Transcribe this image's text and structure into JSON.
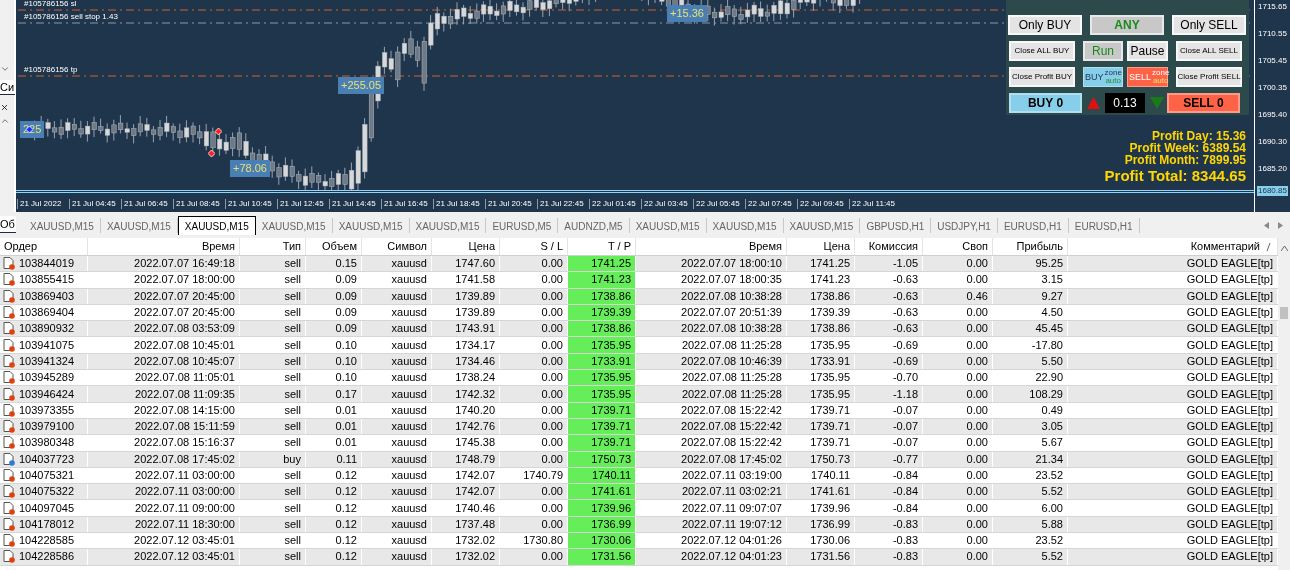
{
  "side_strip": {
    "labels": [
      "Си",
      "Об"
    ]
  },
  "chart": {
    "order_lines": [
      {
        "label": "#105786156 sl",
        "kind": "sl"
      },
      {
        "label": "#105786156 sell stop 1.43",
        "kind": "pending"
      },
      {
        "label": "#105786156 tp",
        "kind": "tp"
      }
    ],
    "profit_labels": [
      "225",
      "+78.06",
      "+255.05",
      "+15.36"
    ],
    "price_axis": [
      {
        "label": "1715.65",
        "current": false
      },
      {
        "label": "1710.55",
        "current": false
      },
      {
        "label": "1705.45",
        "current": false
      },
      {
        "label": "1700.35",
        "current": false
      },
      {
        "label": "1695.40",
        "current": false
      },
      {
        "label": "1690.30",
        "current": false
      },
      {
        "label": "1685.20",
        "current": false
      },
      {
        "label": "1680.85",
        "current": true
      }
    ],
    "time_axis": [
      "21 Jul 2022",
      "21 Jul 04:45",
      "21 Jul 06:45",
      "21 Jul 08:45",
      "21 Jul 10:45",
      "21 Jul 12:45",
      "21 Jul 14:45",
      "21 Jul 16:45",
      "21 Jul 18:45",
      "21 Jul 20:45",
      "21 Jul 22:45",
      "22 Jul 01:45",
      "22 Jul 03:45",
      "22 Jul 05:45",
      "22 Jul 07:45",
      "22 Jul 09:45",
      "22 Jul 11:45"
    ]
  },
  "panel": {
    "mode_buttons": [
      {
        "label": "Only BUY",
        "selected": false
      },
      {
        "label": "ANY",
        "selected": true
      },
      {
        "label": "Only SELL",
        "selected": false
      }
    ],
    "row2": [
      {
        "label": "Close ALL BUY",
        "kind": "close"
      },
      {
        "label": "Run",
        "kind": "toggle",
        "selected": true
      },
      {
        "label": "Pause",
        "kind": "toggle",
        "selected": false
      },
      {
        "label": "Close ALL SELL",
        "kind": "close"
      }
    ],
    "row3": [
      {
        "label": "Close Profit BUY",
        "kind": "close"
      },
      {
        "label": "BUY",
        "kind": "zone_buy",
        "sup": "zone",
        "sub": "auto"
      },
      {
        "label": "SELL",
        "kind": "zone_sell",
        "sup": "zone",
        "sub": "auto"
      },
      {
        "label": "Close Profit SELL",
        "kind": "close"
      }
    ],
    "buy_counter": "BUY 0",
    "lot": "0.13",
    "sell_counter": "SELL 0"
  },
  "profit": [
    {
      "text": "Profit Day: 15.36",
      "kind": "period"
    },
    {
      "text": "Profit Week: 6389.54",
      "kind": "period"
    },
    {
      "text": "Profit Month: 7899.95",
      "kind": "period"
    },
    {
      "text": "Profit Total: 8344.65",
      "kind": "total"
    }
  ],
  "tabs": [
    {
      "label": "XAUUSD,M15",
      "selected": false
    },
    {
      "label": "XAUUSD,M15",
      "selected": false
    },
    {
      "label": "XAUUSD,M15",
      "selected": true
    },
    {
      "label": "XAUUSD,M15",
      "selected": false
    },
    {
      "label": "XAUUSD,M15",
      "selected": false
    },
    {
      "label": "XAUUSD,M15",
      "selected": false
    },
    {
      "label": "EURUSD,M5",
      "selected": false
    },
    {
      "label": "AUDNZD,M5",
      "selected": false
    },
    {
      "label": "XAUUSD,M15",
      "selected": false
    },
    {
      "label": "XAUUSD,M15",
      "selected": false
    },
    {
      "label": "XAUUSD,M15",
      "selected": false
    },
    {
      "label": "GBPUSD,H1",
      "selected": false
    },
    {
      "label": "USDJPY,H1",
      "selected": false
    },
    {
      "label": "EURUSD,H1",
      "selected": false
    },
    {
      "label": "EURUSD,H1",
      "selected": false
    }
  ],
  "table": {
    "columns": [
      {
        "label": "Ордер",
        "sorted": false
      },
      {
        "label": "Время",
        "sorted": false
      },
      {
        "label": "Тип",
        "sorted": false
      },
      {
        "label": "Объем",
        "sorted": false
      },
      {
        "label": "Символ",
        "sorted": false
      },
      {
        "label": "Цена",
        "sorted": false
      },
      {
        "label": "S / L",
        "sorted": false
      },
      {
        "label": "T / P",
        "sorted": false
      },
      {
        "label": "Время",
        "sorted": false
      },
      {
        "label": "Цена",
        "sorted": false
      },
      {
        "label": "Комиссия",
        "sorted": false
      },
      {
        "label": "Своп",
        "sorted": false
      },
      {
        "label": "Прибыль",
        "sorted": false
      },
      {
        "label": "Комментарий",
        "sorted": true
      }
    ],
    "rows": [
      {
        "kind": "sell",
        "cells": [
          "103844019",
          "2022.07.07 16:49:18",
          "sell",
          "0.15",
          "xauusd",
          "1747.60",
          "0.00",
          "1741.25",
          "2022.07.07 18:00:10",
          "1741.25",
          "-1.05",
          "0.00",
          "95.25",
          "GOLD EAGLE[tp]"
        ]
      },
      {
        "kind": "sell",
        "cells": [
          "103855415",
          "2022.07.07 18:00:00",
          "sell",
          "0.09",
          "xauusd",
          "1741.58",
          "0.00",
          "1741.23",
          "2022.07.07 18:00:35",
          "1741.23",
          "-0.63",
          "0.00",
          "3.15",
          "GOLD EAGLE[tp]"
        ]
      },
      {
        "kind": "sell",
        "cells": [
          "103869403",
          "2022.07.07 20:45:00",
          "sell",
          "0.09",
          "xauusd",
          "1739.89",
          "0.00",
          "1738.86",
          "2022.07.08 10:38:28",
          "1738.86",
          "-0.63",
          "0.46",
          "9.27",
          "GOLD EAGLE[tp]"
        ]
      },
      {
        "kind": "sell",
        "cells": [
          "103869404",
          "2022.07.07 20:45:00",
          "sell",
          "0.09",
          "xauusd",
          "1739.89",
          "0.00",
          "1739.39",
          "2022.07.07 20:51:39",
          "1739.39",
          "-0.63",
          "0.00",
          "4.50",
          "GOLD EAGLE[tp]"
        ]
      },
      {
        "kind": "sell",
        "cells": [
          "103890932",
          "2022.07.08 03:53:09",
          "sell",
          "0.09",
          "xauusd",
          "1743.91",
          "0.00",
          "1738.86",
          "2022.07.08 10:38:28",
          "1738.86",
          "-0.63",
          "0.00",
          "45.45",
          "GOLD EAGLE[tp]"
        ]
      },
      {
        "kind": "sell",
        "cells": [
          "103941075",
          "2022.07.08 10:45:01",
          "sell",
          "0.10",
          "xauusd",
          "1734.17",
          "0.00",
          "1735.95",
          "2022.07.08 11:25:28",
          "1735.95",
          "-0.69",
          "0.00",
          "-17.80",
          "GOLD EAGLE[tp]"
        ]
      },
      {
        "kind": "sell",
        "cells": [
          "103941324",
          "2022.07.08 10:45:07",
          "sell",
          "0.10",
          "xauusd",
          "1734.46",
          "0.00",
          "1733.91",
          "2022.07.08 10:46:39",
          "1733.91",
          "-0.69",
          "0.00",
          "5.50",
          "GOLD EAGLE[tp]"
        ]
      },
      {
        "kind": "sell",
        "cells": [
          "103945289",
          "2022.07.08 11:05:01",
          "sell",
          "0.10",
          "xauusd",
          "1738.24",
          "0.00",
          "1735.95",
          "2022.07.08 11:25:28",
          "1735.95",
          "-0.70",
          "0.00",
          "22.90",
          "GOLD EAGLE[tp]"
        ]
      },
      {
        "kind": "sell",
        "cells": [
          "103946424",
          "2022.07.08 11:09:35",
          "sell",
          "0.17",
          "xauusd",
          "1742.32",
          "0.00",
          "1735.95",
          "2022.07.08 11:25:28",
          "1735.95",
          "-1.18",
          "0.00",
          "108.29",
          "GOLD EAGLE[tp]"
        ]
      },
      {
        "kind": "sell",
        "cells": [
          "103973355",
          "2022.07.08 14:15:00",
          "sell",
          "0.01",
          "xauusd",
          "1740.20",
          "0.00",
          "1739.71",
          "2022.07.08 15:22:42",
          "1739.71",
          "-0.07",
          "0.00",
          "0.49",
          "GOLD EAGLE[tp]"
        ]
      },
      {
        "kind": "sell",
        "cells": [
          "103979100",
          "2022.07.08 15:11:59",
          "sell",
          "0.01",
          "xauusd",
          "1742.76",
          "0.00",
          "1739.71",
          "2022.07.08 15:22:42",
          "1739.71",
          "-0.07",
          "0.00",
          "3.05",
          "GOLD EAGLE[tp]"
        ]
      },
      {
        "kind": "sell",
        "cells": [
          "103980348",
          "2022.07.08 15:16:37",
          "sell",
          "0.01",
          "xauusd",
          "1745.38",
          "0.00",
          "1739.71",
          "2022.07.08 15:22:42",
          "1739.71",
          "-0.07",
          "0.00",
          "5.67",
          "GOLD EAGLE[tp]"
        ]
      },
      {
        "kind": "buy",
        "cells": [
          "104037723",
          "2022.07.08 17:45:02",
          "buy",
          "0.11",
          "xauusd",
          "1748.79",
          "0.00",
          "1750.73",
          "2022.07.08 17:45:02",
          "1750.73",
          "-0.77",
          "0.00",
          "21.34",
          "GOLD EAGLE[tp]"
        ]
      },
      {
        "kind": "sell",
        "cells": [
          "104075321",
          "2022.07.11 03:00:00",
          "sell",
          "0.12",
          "xauusd",
          "1742.07",
          "1740.79",
          "1740.11",
          "2022.07.11 03:19:00",
          "1740.11",
          "-0.84",
          "0.00",
          "23.52",
          "GOLD EAGLE[tp]"
        ]
      },
      {
        "kind": "sell",
        "cells": [
          "104075322",
          "2022.07.11 03:00:00",
          "sell",
          "0.12",
          "xauusd",
          "1742.07",
          "0.00",
          "1741.61",
          "2022.07.11 03:02:21",
          "1741.61",
          "-0.84",
          "0.00",
          "5.52",
          "GOLD EAGLE[tp]"
        ]
      },
      {
        "kind": "sell",
        "cells": [
          "104097045",
          "2022.07.11 09:00:00",
          "sell",
          "0.12",
          "xauusd",
          "1740.46",
          "0.00",
          "1739.96",
          "2022.07.11 09:07:07",
          "1739.96",
          "-0.84",
          "0.00",
          "6.00",
          "GOLD EAGLE[tp]"
        ]
      },
      {
        "kind": "sell",
        "cells": [
          "104178012",
          "2022.07.11 18:30:00",
          "sell",
          "0.12",
          "xauusd",
          "1737.48",
          "0.00",
          "1736.99",
          "2022.07.11 19:07:12",
          "1736.99",
          "-0.83",
          "0.00",
          "5.88",
          "GOLD EAGLE[tp]"
        ]
      },
      {
        "kind": "sell",
        "cells": [
          "104228585",
          "2022.07.12 03:45:01",
          "sell",
          "0.12",
          "xauusd",
          "1732.02",
          "1730.80",
          "1730.06",
          "2022.07.12 04:01:26",
          "1730.06",
          "-0.83",
          "0.00",
          "23.52",
          "GOLD EAGLE[tp]"
        ]
      },
      {
        "kind": "sell",
        "cells": [
          "104228586",
          "2022.07.12 03:45:01",
          "sell",
          "0.12",
          "xauusd",
          "1732.02",
          "0.00",
          "1731.56",
          "2022.07.12 04:01:23",
          "1731.56",
          "-0.83",
          "0.00",
          "5.52",
          "GOLD EAGLE[tp]"
        ]
      }
    ]
  }
}
